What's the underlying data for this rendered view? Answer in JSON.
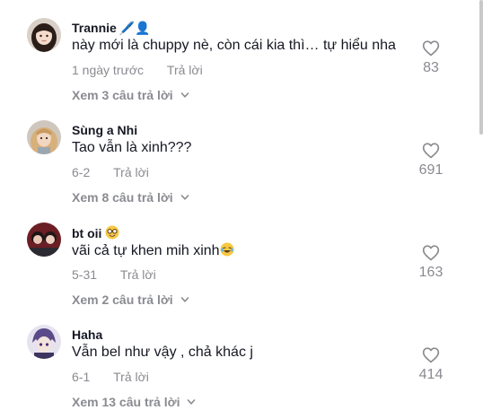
{
  "comments": [
    {
      "username": "Trannie",
      "username_decor": "🖊️👤",
      "text": "này mới là chuppy nè, còn cái kia thì… tự hiểu nha",
      "time": "1 ngày trước",
      "reply_label": "Trả lời",
      "view_replies": "Xem 3 câu trả lời",
      "likes": "83",
      "avatar_icon": "girl-avatar-icon"
    },
    {
      "username": "Sùng a Nhi",
      "text": "Tao vẫn là xinh???",
      "time": "6-2",
      "reply_label": "Trả lời",
      "view_replies": "Xem 8 câu trả lời",
      "likes": "691",
      "avatar_icon": "girl-blonde-avatar-icon"
    },
    {
      "username": "bt oii",
      "username_decor": "nerd-face-emoji",
      "text": "vãi cả tự khen mih xinh",
      "text_emoji": "laughing-tears-emoji",
      "time": "5-31",
      "reply_label": "Trả lời",
      "view_replies": "Xem 2 câu trả lời",
      "likes": "163",
      "avatar_icon": "couple-avatar-icon"
    },
    {
      "username": "Haha",
      "text": "Vẫn bel như vậy , chả khác j",
      "time": "6-1",
      "reply_label": "Trả lời",
      "view_replies": "Xem 13 câu trả lời",
      "likes": "414",
      "avatar_icon": "anime-avatar-icon"
    }
  ],
  "colors": {
    "text": "#161823",
    "secondary": "#8a8b91"
  }
}
